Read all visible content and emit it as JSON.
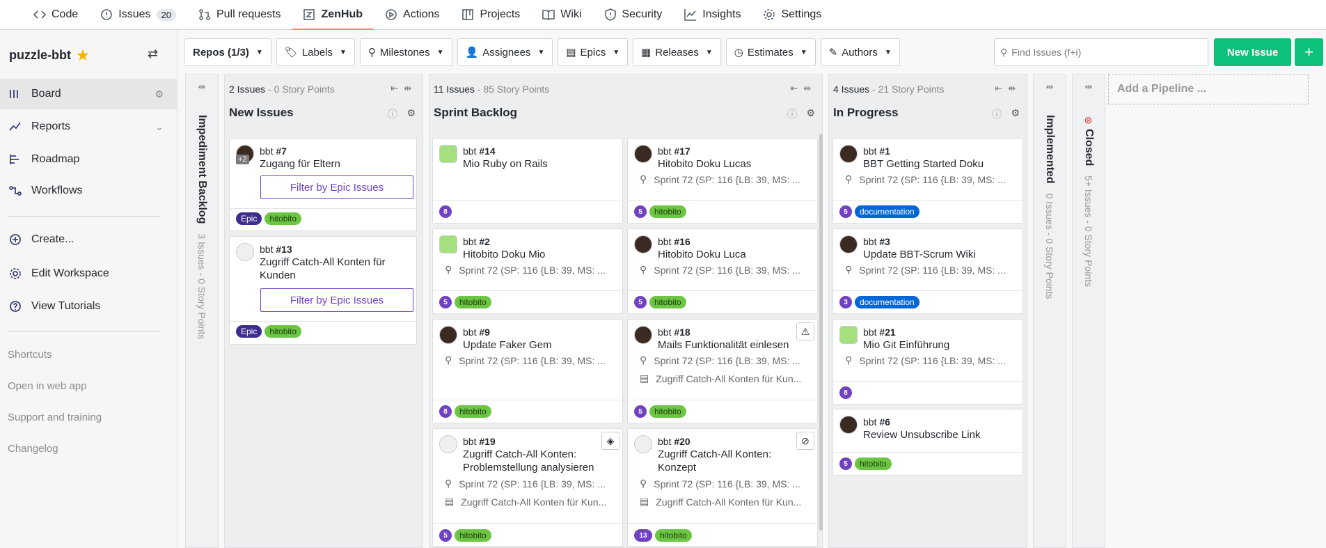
{
  "topnav": {
    "tabs": [
      {
        "label": "Code"
      },
      {
        "label": "Issues",
        "count": "20"
      },
      {
        "label": "Pull requests"
      },
      {
        "label": "ZenHub"
      },
      {
        "label": "Actions"
      },
      {
        "label": "Projects"
      },
      {
        "label": "Wiki"
      },
      {
        "label": "Security"
      },
      {
        "label": "Insights"
      },
      {
        "label": "Settings"
      }
    ]
  },
  "sidebar": {
    "workspace": "puzzle-bbt",
    "items": [
      {
        "label": "Board"
      },
      {
        "label": "Reports"
      },
      {
        "label": "Roadmap"
      },
      {
        "label": "Workflows"
      }
    ],
    "actions": [
      {
        "label": "Create..."
      },
      {
        "label": "Edit Workspace"
      },
      {
        "label": "View Tutorials"
      }
    ],
    "links": [
      "Shortcuts",
      "Open in web app",
      "Support and training",
      "Changelog"
    ]
  },
  "filters": {
    "repos": "Repos (1/3)",
    "labels": "Labels",
    "milestones": "Milestones",
    "assignees": "Assignees",
    "epics": "Epics",
    "releases": "Releases",
    "estimates": "Estimates",
    "authors": "Authors",
    "search_placeholder": "Find Issues (f+i)",
    "new_issue": "New Issue",
    "plus": "+"
  },
  "collapsed": {
    "impediment": {
      "name": "Impediment Backlog",
      "summary": "3 Issues - 0 Story Points"
    },
    "implemented": {
      "name": "Implemented",
      "summary": "0 Issues - 0 Story Points"
    },
    "closed": {
      "name": "Closed",
      "summary": "5+ Issues - 0 Story Points"
    }
  },
  "pipelines": {
    "new_issues": {
      "issues": "2 Issues",
      "points": " - 0 Story Points",
      "name": "New Issues"
    },
    "sprint_backlog": {
      "issues": "11 Issues",
      "points": " - 85 Story Points",
      "name": "Sprint Backlog"
    },
    "in_progress": {
      "issues": "4 Issues",
      "points": " - 21 Story Points",
      "name": "In Progress"
    },
    "add_pipeline": "Add a Pipeline ..."
  },
  "common": {
    "milestone": "Sprint 72 (SP: 116 {LB: 39, MS: ...",
    "epic": "Zugriff Catch-All Konten für Kun...",
    "filter_epic": "Filter by Epic Issues",
    "lbl_epic": "Epic",
    "lbl_hitobito": "hitobito",
    "lbl_doc": "documentation",
    "plus2": "+2"
  },
  "cards": {
    "c7": {
      "repo": "bbt",
      "num": "#7",
      "title": "Zugang für Eltern"
    },
    "c13": {
      "repo": "bbt",
      "num": "#13",
      "title": "Zugriff Catch-All Konten für Kunden"
    },
    "c14": {
      "repo": "bbt",
      "num": "#14",
      "title": "Mio Ruby on Rails",
      "est": "8"
    },
    "c17": {
      "repo": "bbt",
      "num": "#17",
      "title": "Hitobito Doku Lucas",
      "est": "5"
    },
    "c2": {
      "repo": "bbt",
      "num": "#2",
      "title": "Hitobito Doku Mio",
      "est": "5"
    },
    "c16": {
      "repo": "bbt",
      "num": "#16",
      "title": "Hitobito Doku Luca",
      "est": "5"
    },
    "c9": {
      "repo": "bbt",
      "num": "#9",
      "title": "Update Faker Gem",
      "est": "8"
    },
    "c18": {
      "repo": "bbt",
      "num": "#18",
      "title": "Mails Funktionalität einlesen",
      "est": "5"
    },
    "c19": {
      "repo": "bbt",
      "num": "#19",
      "title": "Zugriff Catch-All Konten: Problemstellung analysieren",
      "est": "5"
    },
    "c20": {
      "repo": "bbt",
      "num": "#20",
      "title": "Zugriff Catch-All Konten: Konzept",
      "est": "13"
    },
    "c1": {
      "repo": "bbt",
      "num": "#1",
      "title": "BBT Getting Started Doku",
      "est": "5"
    },
    "c3": {
      "repo": "bbt",
      "num": "#3",
      "title": "Update BBT-Scrum Wiki",
      "est": "3"
    },
    "c21": {
      "repo": "bbt",
      "num": "#21",
      "title": "Mio Git Einführung",
      "est": "8"
    },
    "c6": {
      "repo": "bbt",
      "num": "#6",
      "title": "Review Unsubscribe Link",
      "est": "5"
    }
  }
}
